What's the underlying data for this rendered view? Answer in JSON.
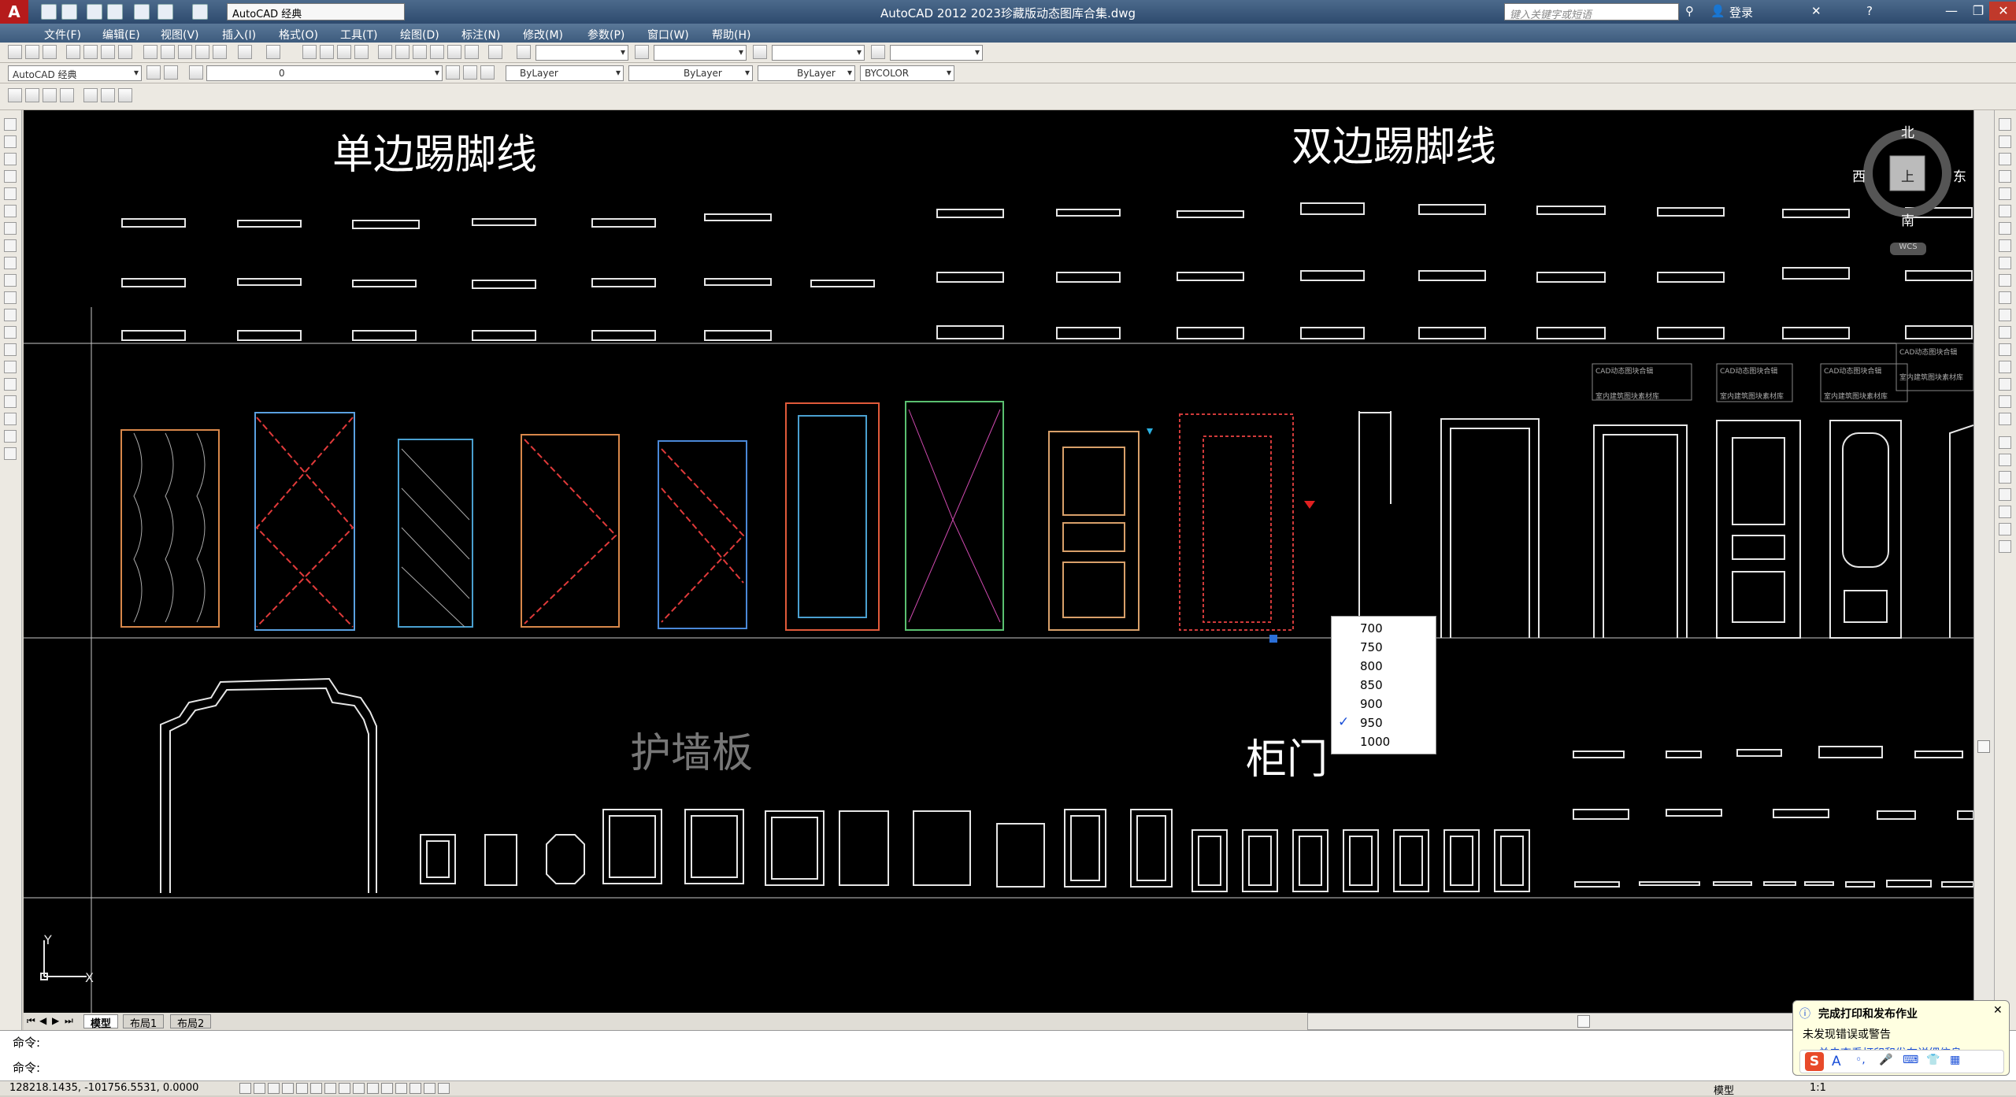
{
  "titlebar": {
    "app_icon": "A",
    "workspace": "AutoCAD 经典",
    "title": "AutoCAD 2012    2023珍藏版动态图库合集.dwg",
    "search_placeholder": "键入关键字或短语",
    "login": "登录"
  },
  "menu": [
    "文件(F)",
    "编辑(E)",
    "视图(V)",
    "插入(I)",
    "格式(O)",
    "工具(T)",
    "绘图(D)",
    "标注(N)",
    "修改(M)",
    "参数(P)",
    "窗口(W)",
    "帮助(H)"
  ],
  "toolbar2": {
    "workspace_combo": "AutoCAD 经典",
    "layer_combo": "0",
    "color_combo": "ByLayer",
    "linetype_combo": "ByLayer",
    "lineweight_combo": "ByLayer",
    "plotstyle_combo": "BYCOLOR"
  },
  "drawing": {
    "labels": {
      "single_baseboard": "单边踢脚线",
      "double_baseboard": "双边踢脚线",
      "wall_panel": "护墙板",
      "cabinet_door": "柜门"
    },
    "small_notes": [
      "CAD动态图块合辑",
      "室内建筑图块素材库"
    ],
    "compass": {
      "north": "北",
      "south": "南",
      "east": "东",
      "west": "西",
      "top": "上",
      "ucs": "WCS"
    },
    "axis": {
      "y": "Y",
      "x": "X"
    }
  },
  "dropdown": {
    "options": [
      "700",
      "750",
      "800",
      "850",
      "900",
      "950",
      "1000"
    ],
    "selected": "950",
    "check": "✓"
  },
  "tabs": [
    "模型",
    "布局1",
    "布局2"
  ],
  "command": {
    "line1": "命令:",
    "line2": "命令:"
  },
  "status": {
    "coords": "128218.1435, -101756.5531, 0.0000",
    "model": "模型",
    "scale": "1:1"
  },
  "notification": {
    "title": "完成打印和发布作业",
    "body": "未发现错误或警告",
    "link": "单击查看打印和发布详细信息"
  },
  "ime": {
    "brand": "S",
    "mode": "A"
  }
}
